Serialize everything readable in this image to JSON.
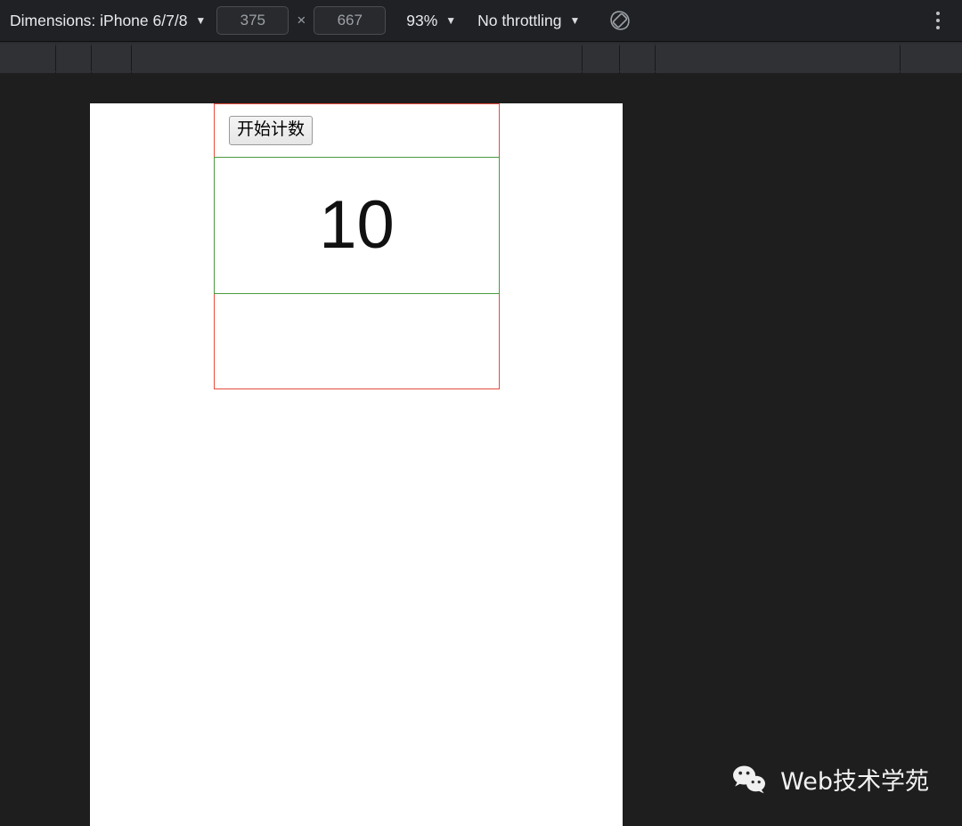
{
  "device_toolbar": {
    "dimensions_label": "Dimensions: iPhone 6/7/8",
    "caret": "▼",
    "width_value": "375",
    "height_value": "667",
    "multiply_symbol": "×",
    "zoom_label": "93%",
    "throttling_label": "No throttling",
    "rotate_icon": "rotate-device-icon",
    "more_options_icon": "three-dot-menu-icon"
  },
  "emulated_page": {
    "start_button_label": "开始计数",
    "counter_value": "10",
    "outer_box_border_color": "#e74c3c",
    "inner_box_border_color": "#4a9a3f"
  },
  "watermark": {
    "logo_icon": "wechat-logo-icon",
    "text": "Web技术学苑"
  }
}
